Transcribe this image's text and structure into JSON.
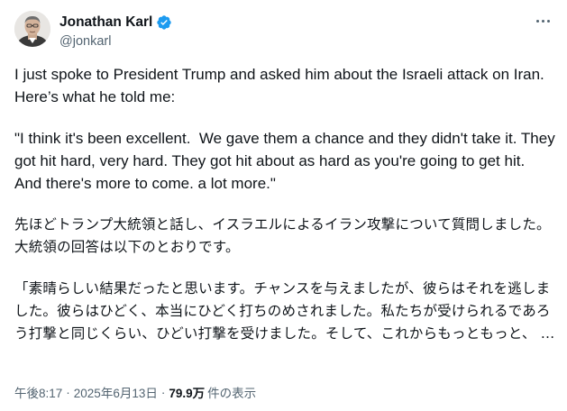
{
  "author": {
    "display_name": "Jonathan Karl",
    "handle": "@jonkarl",
    "verified": true
  },
  "icons": {
    "more": "more-horizontal-icon",
    "verified": "verified-badge-icon"
  },
  "colors": {
    "verified_blue": "#1d9bf0",
    "text_primary": "#0f1419",
    "text_secondary": "#536471"
  },
  "tweet": {
    "paragraphs": [
      "I just spoke to President Trump and asked him about the Israeli attack on Iran. Here’s what he told me:",
      "\"I think it's been excellent.  We gave them a chance and they didn't take it. They got hit hard, very hard. They got hit about as hard as you're going to get hit. And there's more to come. a lot more.\"",
      "先ほどトランプ大統領と話し、イスラエルによるイラン攻撃について質問しました。大統領の回答は以下のとおりです。",
      "「素晴らしい結果だったと思います。チャンスを与えましたが、彼らはそれを逃しました。彼らはひどく、本当にひどく打ちのめされました。私たちが受けられるであろう打撃と同じくらい、ひどい打撃を受けました。そして、これからもっともっと、 …"
    ]
  },
  "meta": {
    "time": "午後8:17",
    "separator": "·",
    "date": "2025年6月13日",
    "views_count": "79.9万",
    "views_label": "件の表示"
  }
}
